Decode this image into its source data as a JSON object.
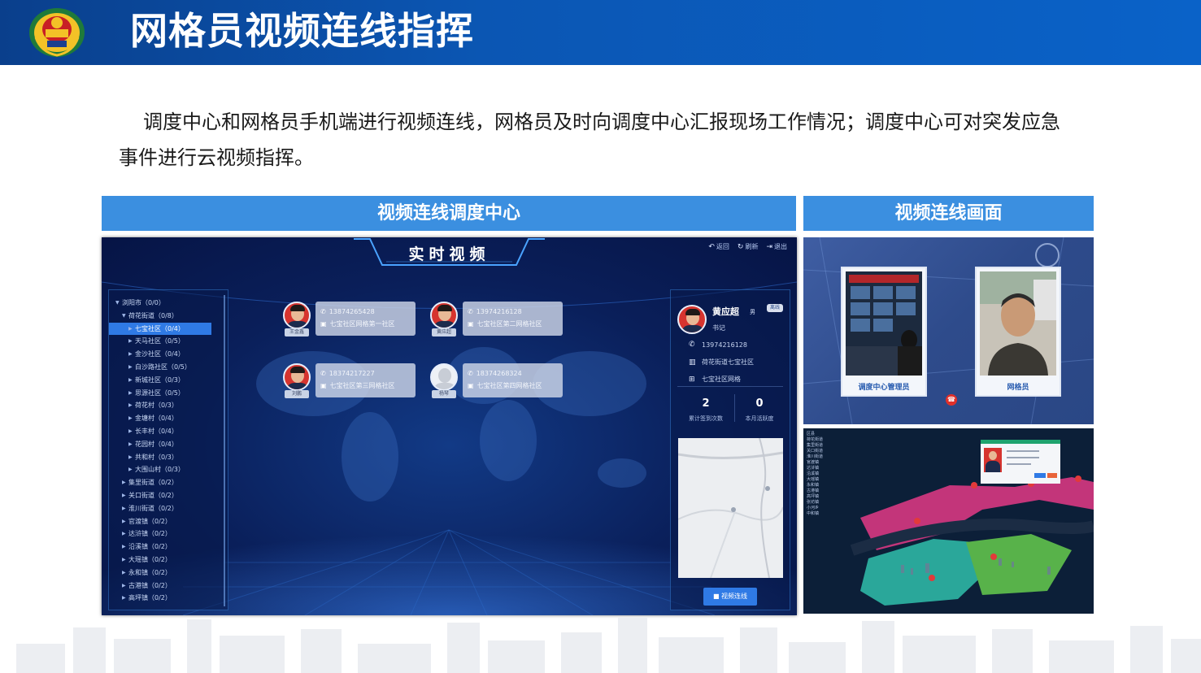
{
  "header": {
    "title": "网格员视频连线指挥"
  },
  "intro": "调度中心和网格员手机端进行视频连线，网格员及时向调度中心汇报现场工作情况；调度中心可对突发应急事件进行云视频指挥。",
  "sections": {
    "left_label": "视频连线调度中心",
    "right_label": "视频连线画面"
  },
  "dispatch": {
    "title": "实时视频",
    "actions": [
      {
        "icon": "back-icon",
        "label": "返回"
      },
      {
        "icon": "refresh-icon",
        "label": "刷新"
      },
      {
        "icon": "exit-icon",
        "label": "退出"
      }
    ],
    "tree": [
      {
        "label": "浏阳市（0/0）",
        "level": 0,
        "expanded": true
      },
      {
        "label": "荷花街道（0/8）",
        "level": 1,
        "expanded": true
      },
      {
        "label": "七宝社区（0/4）",
        "level": 2,
        "selected": true
      },
      {
        "label": "天马社区（0/5）",
        "level": 2
      },
      {
        "label": "金沙社区（0/4）",
        "level": 2
      },
      {
        "label": "白沙路社区（0/5）",
        "level": 2
      },
      {
        "label": "新城社区（0/3）",
        "level": 2
      },
      {
        "label": "思源社区（0/5）",
        "level": 2
      },
      {
        "label": "荷花村（0/3）",
        "level": 2
      },
      {
        "label": "金塘村（0/4）",
        "level": 2
      },
      {
        "label": "长丰村（0/4）",
        "level": 2
      },
      {
        "label": "花园村（0/4）",
        "level": 2
      },
      {
        "label": "共和村（0/3）",
        "level": 2
      },
      {
        "label": "大围山村（0/3）",
        "level": 2
      },
      {
        "label": "集里街道（0/2）",
        "level": 1
      },
      {
        "label": "关口街道（0/2）",
        "level": 1
      },
      {
        "label": "淮川街道（0/2）",
        "level": 1
      },
      {
        "label": "官渡镇（0/2）",
        "level": 1
      },
      {
        "label": "达浒镇（0/2）",
        "level": 1
      },
      {
        "label": "沿溪镇（0/2）",
        "level": 1
      },
      {
        "label": "大瑶镇（0/2）",
        "level": 1
      },
      {
        "label": "永和镇（0/2）",
        "level": 1
      },
      {
        "label": "古港镇（0/2）",
        "level": 1
      },
      {
        "label": "高坪镇（0/2）",
        "level": 1
      }
    ],
    "people": [
      {
        "name": "王金鑫",
        "phone": "13874265428",
        "place": "七宝社区网格第一社区"
      },
      {
        "name": "黄应超",
        "phone": "13974216128",
        "place": "七宝社区第二网格社区"
      },
      {
        "name": "刘鹏",
        "phone": "18374217227",
        "place": "七宝社区第三网格社区"
      },
      {
        "name": "杨琴",
        "phone": "18374268324",
        "place": "七宝社区第四网格社区"
      }
    ],
    "detail": {
      "name": "黄应超",
      "gender": "男",
      "badge": "离线",
      "role": "书记",
      "phone": "13974216128",
      "org": "荷花街道七宝社区",
      "area": "七宝社区网格",
      "stat1_value": "2",
      "stat1_label": "累计签到次数",
      "stat2_value": "0",
      "stat2_label": "本月活跃度",
      "button": "视频连线"
    }
  },
  "video": {
    "left_caption": "调度中心管理员",
    "right_caption": "网格员"
  },
  "map3d": {
    "list": [
      "区县",
      "荷花街道",
      "集里街道",
      "关口街道",
      "淮川街道",
      "官渡镇",
      "达浒镇",
      "沿溪镇",
      "大瑶镇",
      "永和镇",
      "古港镇",
      "高坪镇",
      "张坊镇",
      "小河乡",
      "中和镇"
    ]
  },
  "colors": {
    "header_blue": "#0b56b3",
    "label_blue": "#3b8fe0",
    "accent_blue": "#2f7ae5",
    "alert_red": "#d6342f"
  }
}
